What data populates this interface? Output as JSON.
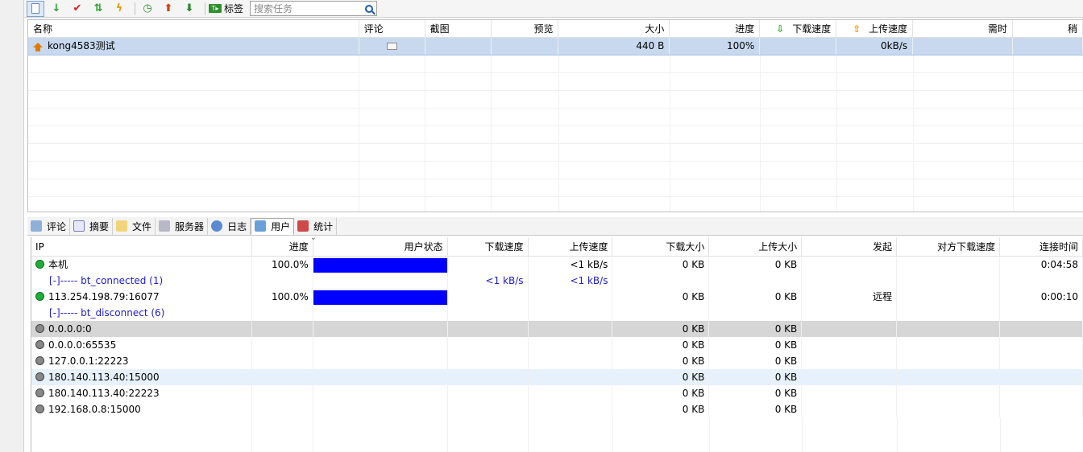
{
  "toolbar": {
    "tag_label": "标签",
    "search_placeholder": "搜索任务"
  },
  "tasks": {
    "headers": {
      "name": "名称",
      "comment": "评论",
      "screenshot": "截图",
      "preview": "预览",
      "size": "大小",
      "progress": "进度",
      "download_speed": "下载速度",
      "upload_speed": "上传速度",
      "eta": "需时",
      "more": "稍"
    },
    "rows": [
      {
        "name": "kong4583测试",
        "size": "440 B",
        "progress": "100%",
        "upload_speed": "0kB/s"
      }
    ]
  },
  "tabs": [
    {
      "label": "评论"
    },
    {
      "label": "摘要"
    },
    {
      "label": "文件"
    },
    {
      "label": "服务器"
    },
    {
      "label": "日志"
    },
    {
      "label": "用户"
    },
    {
      "label": "统计"
    }
  ],
  "peers": {
    "headers": {
      "ip": "IP",
      "progress": "进度",
      "status": "用户状态",
      "down_speed": "下载速度",
      "up_speed": "上传速度",
      "down_size": "下载大小",
      "up_size": "上传大小",
      "initiator": "发起",
      "remote_down_speed": "对方下载速度",
      "conn_time": "连接时间"
    },
    "local": {
      "ip": "本机",
      "progress": "100.0%",
      "progress_value": 1.0,
      "up_speed": "<1 kB/s",
      "down_size": "0 KB",
      "up_size": "0 KB",
      "conn_time": "0:04:58"
    },
    "group_connected": {
      "label": "[-]----- bt_connected (1)",
      "down_speed": "<1 kB/s",
      "up_speed": "<1 kB/s"
    },
    "connected_peer": {
      "ip": "113.254.198.79:16077",
      "progress": "100.0%",
      "progress_value": 1.0,
      "down_size": "0 KB",
      "up_size": "0 KB",
      "initiator": "远程",
      "conn_time": "0:00:10"
    },
    "group_disconnected": {
      "label": "[-]----- bt_disconnect (6)"
    },
    "disconnected": [
      {
        "ip": "0.0.0.0:0",
        "down_size": "0 KB",
        "up_size": "0 KB"
      },
      {
        "ip": "0.0.0.0:65535",
        "down_size": "0 KB",
        "up_size": "0 KB"
      },
      {
        "ip": "127.0.0.1:22223",
        "down_size": "0 KB",
        "up_size": "0 KB"
      },
      {
        "ip": "180.140.113.40:15000",
        "down_size": "0 KB",
        "up_size": "0 KB"
      },
      {
        "ip": "180.140.113.40:22223",
        "down_size": "0 KB",
        "up_size": "0 KB"
      },
      {
        "ip": "192.168.0.8:15000",
        "down_size": "0 KB",
        "up_size": "0 KB"
      }
    ]
  },
  "colors": {
    "selection": "#c8d9ef",
    "progress_bar": "#0000ff",
    "link": "#2020c8"
  }
}
